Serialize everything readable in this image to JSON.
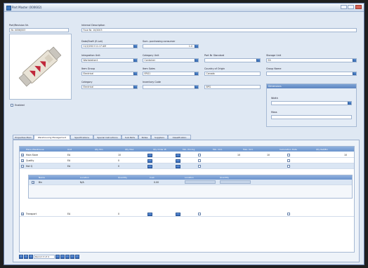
{
  "window": {
    "title": "Part Master (000602)"
  },
  "part": {
    "part_number_label": "Part/Revision Nr.",
    "part_number": "Nr. 0056/003",
    "image_caption": "",
    "enabled_label": "Enabled"
  },
  "general": {
    "desc_label": "Internal Description",
    "desc_value": "Fuse Nr. 10/2003",
    "date_label": "Date/Draft (E-Lot)",
    "date_value": "11/2/2013 11:17 AM",
    "purch_label": "Sum. purchasing consumer",
    "purch_value": "1.0",
    "fields": [
      {
        "label": "Integration Unit",
        "value": "Workstation1"
      },
      {
        "label": "Category Unit",
        "value": "Container"
      },
      {
        "label": "Part Nr Standard",
        "value": ""
      },
      {
        "label": "Storage Unit",
        "value": "EA"
      },
      {
        "label": "Item Group",
        "value": "Electrical"
      },
      {
        "label": "Item Sales",
        "value": "ERG1"
      },
      {
        "label": "Country of Origin",
        "value": "Canada"
      },
      {
        "label": "Group Name",
        "value": ""
      },
      {
        "label": "Category",
        "value": "Electrical"
      },
      {
        "label": "Inventory Code",
        "value": ""
      },
      {
        "label": "",
        "value": "BPG"
      }
    ],
    "dimensions_title": "Dimensions",
    "dim_fields": [
      {
        "label": "Width",
        "value": ""
      },
      {
        "label": "Mass",
        "value": ""
      }
    ]
  },
  "tabs": [
    "Properties Main",
    "Warehousing Management",
    "Specifications",
    "Special Instructions",
    "Sub Parts",
    "Notes",
    "Suppliers",
    "Classification"
  ],
  "grid": {
    "headers": [
      "Place Warehouse",
      "Unit",
      "Qty Min",
      "Qty Max",
      "Qty Order Pt",
      "Min. Pricing",
      "Min. Ord.",
      "Max. Ord.",
      "Calculation Date",
      "Qty Ret/Bin"
    ],
    "rows": [
      {
        "place": "Main Store",
        "unit": "EA",
        "qmin": "10",
        "qmax": "",
        "c5": "",
        "c7": "10",
        "c8": "10",
        "c10": "10"
      },
      {
        "place": "Quality",
        "unit": "EA",
        "qmin": "0",
        "qmax": "",
        "c5": "",
        "c7": "",
        "c8": "",
        "c10": ""
      },
      {
        "place": "Hot Q",
        "unit": "EA",
        "qmin": "0",
        "qmax": "",
        "c5": "",
        "c7": "",
        "c8": "",
        "c10": ""
      }
    ],
    "subgrid": {
      "headers": [
        "Name",
        "Location",
        "Quantity",
        "Cost",
        "Location",
        "Quantity"
      ],
      "row": {
        "name": "Bin",
        "loc": "N/A",
        "qty": "",
        "cost": "0.00"
      }
    },
    "last_row": {
      "place": "Transport",
      "unit": "EA",
      "qmin": "0"
    },
    "pager_text": "Record 3 of 4"
  },
  "colors": {
    "accent": "#2f64ad",
    "header": "#6a93cc",
    "window_bg": "#dfe8f3"
  }
}
